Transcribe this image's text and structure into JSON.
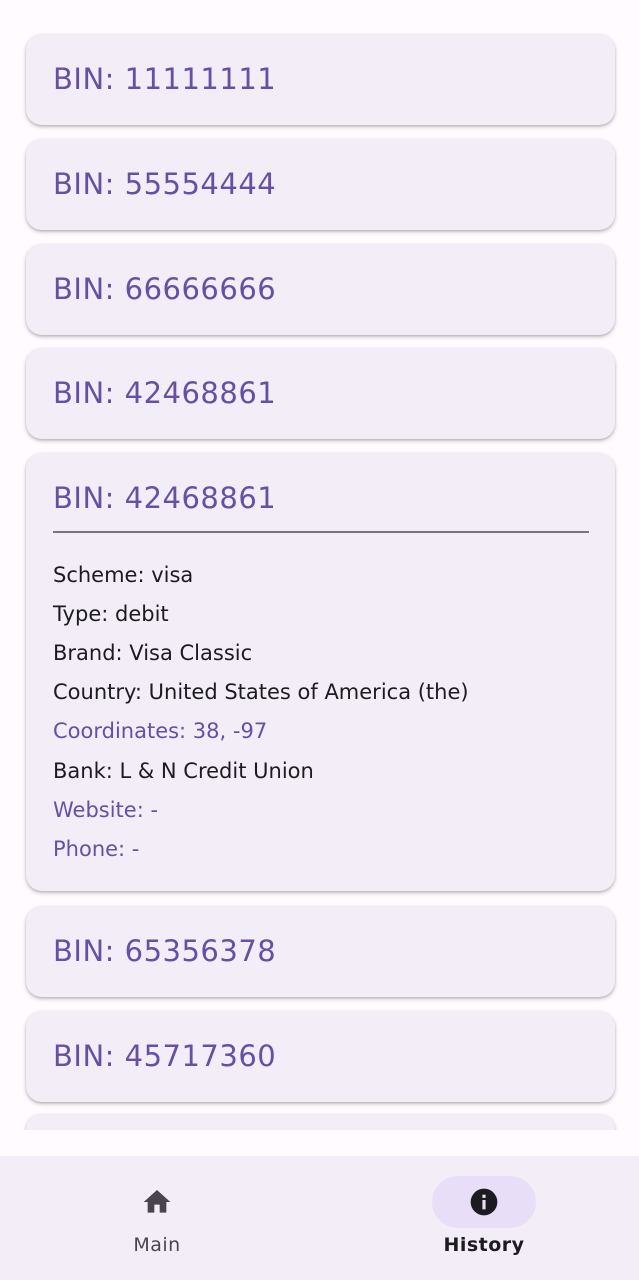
{
  "history": {
    "items": [
      {
        "title": "BIN: 11111111"
      },
      {
        "title": "BIN: 55554444"
      },
      {
        "title": "BIN: 66666666"
      },
      {
        "title": "BIN: 42468861"
      },
      {
        "title": "BIN: 42468861",
        "expanded": true,
        "details": {
          "scheme": "Scheme: visa",
          "type": "Type: debit",
          "brand": "Brand: Visa Classic",
          "country": "Country: United States of America (the)",
          "coordinates": "Coordinates: 38, -97",
          "bank": "Bank: L & N Credit Union",
          "website": "Website: -",
          "phone": "Phone: -"
        }
      },
      {
        "title": "BIN: 65356378"
      },
      {
        "title": "BIN: 45717360"
      }
    ]
  },
  "bottom_nav": {
    "items": [
      {
        "label": "Main",
        "icon": "home-icon",
        "selected": false
      },
      {
        "label": "History",
        "icon": "info-icon",
        "selected": true
      }
    ]
  },
  "colors": {
    "accent": "#6750a4",
    "card_background": "#f3edf7",
    "selected_pill": "#e8def8",
    "text": "#1c1b1f"
  }
}
